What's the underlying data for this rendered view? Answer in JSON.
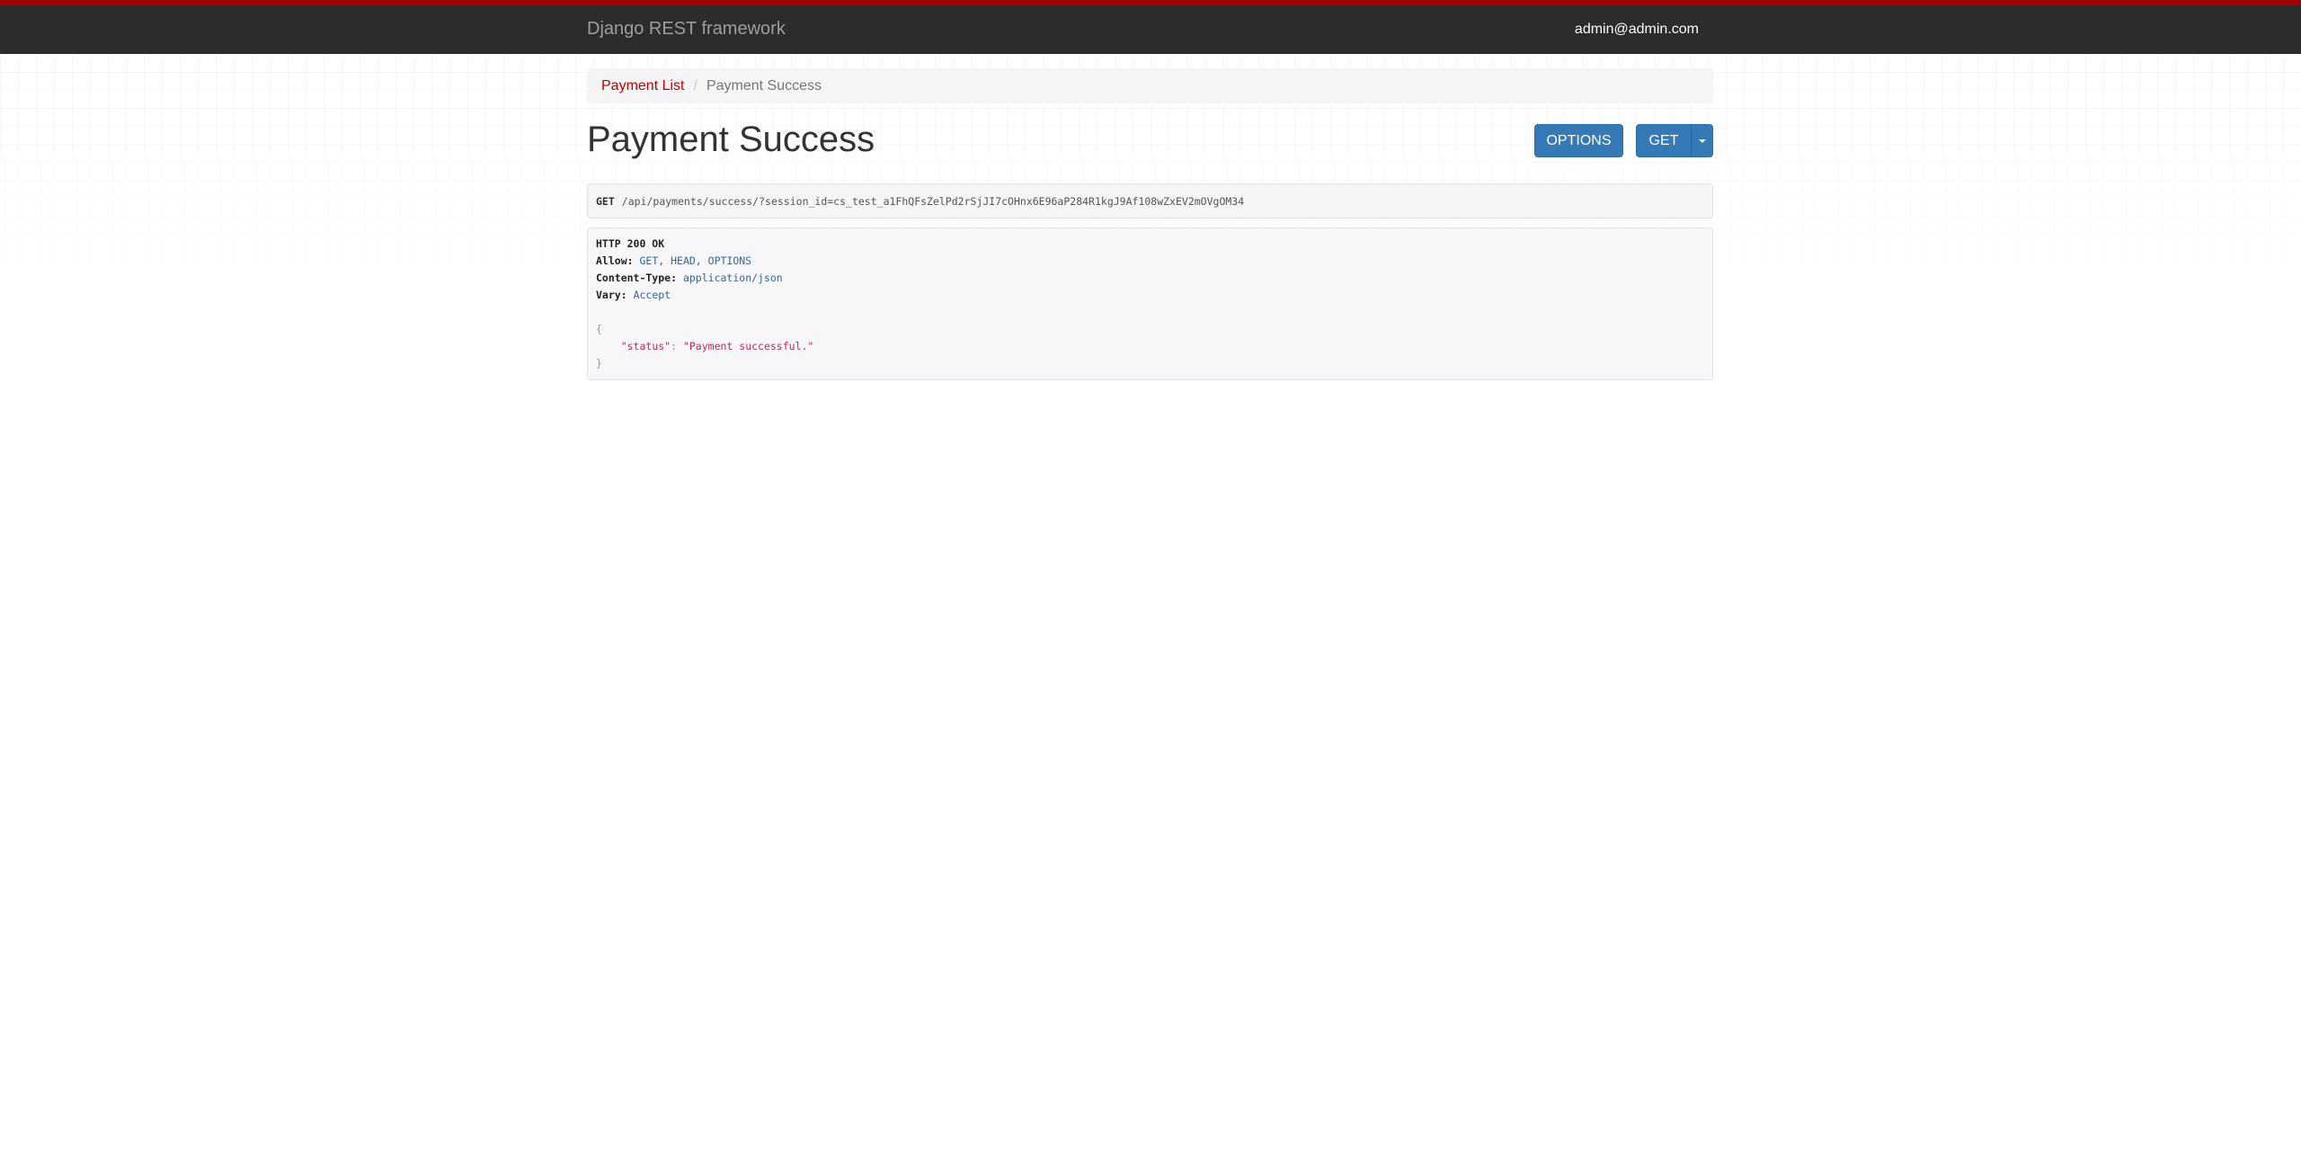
{
  "navbar": {
    "brand": "Django REST framework",
    "user": "admin@admin.com",
    "accent_color": "#a30000",
    "background_color": "#2c2c2c"
  },
  "breadcrumb": {
    "parent": "Payment List",
    "separator": "/",
    "current": "Payment Success"
  },
  "page": {
    "title": "Payment Success"
  },
  "buttons": {
    "options": "OPTIONS",
    "get": "GET",
    "color": "#337ab7"
  },
  "request": {
    "method": "GET",
    "path": "/api/payments/success/?session_id=cs_test_a1FhQFsZelPd2rSjJI7cOHnx6E96aP284R1kgJ9Af108wZxEV2mOVgOM34"
  },
  "response": {
    "status_line": "HTTP 200 OK",
    "headers": [
      {
        "key": "Allow:",
        "value": "GET, HEAD, OPTIONS"
      },
      {
        "key": "Content-Type:",
        "value": "application/json"
      },
      {
        "key": "Vary:",
        "value": "Accept"
      }
    ],
    "body": {
      "open_brace": "{",
      "key": "\"status\"",
      "colon": ": ",
      "value": "\"Payment successful.\"",
      "close_brace": "}"
    }
  }
}
